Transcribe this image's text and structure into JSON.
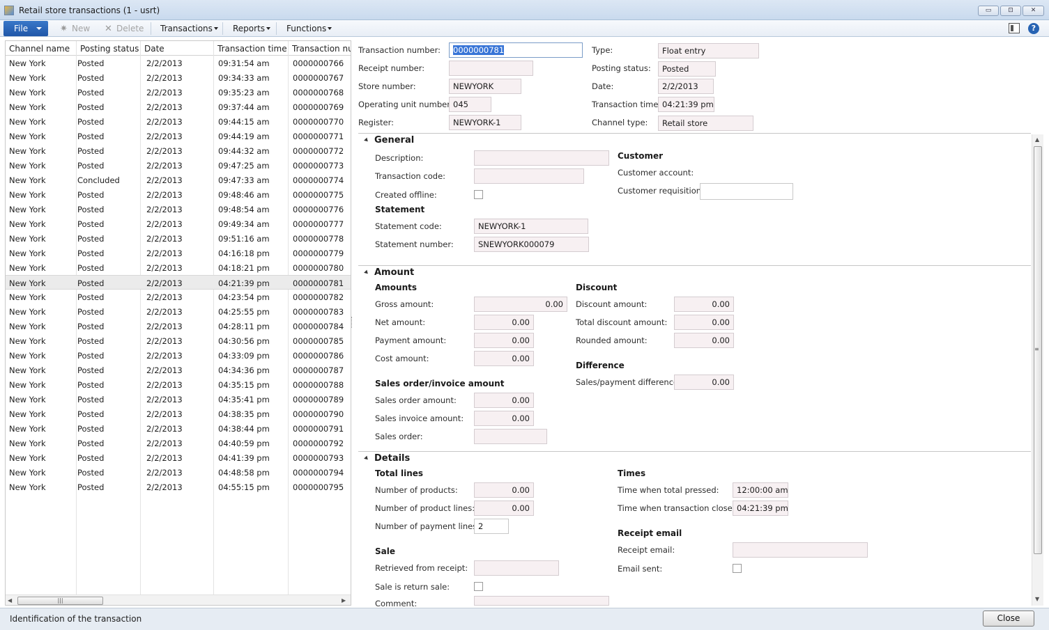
{
  "window": {
    "title": "Retail store transactions (1 - usrt)",
    "min_glyph": "▭",
    "max_glyph": "⊡",
    "close_glyph": "✕"
  },
  "toolbar": {
    "file_label": "File",
    "new_label": "New",
    "delete_label": "Delete",
    "transactions_label": "Transactions",
    "reports_label": "Reports",
    "functions_label": "Functions",
    "new_icon_glyph": "✷",
    "delete_icon_glyph": "✕",
    "help_glyph": "?"
  },
  "grid": {
    "columns": [
      "Channel name",
      "Posting status",
      "Date",
      "Transaction time",
      "Transaction number"
    ],
    "selected_index": 15,
    "rows": [
      [
        "New York",
        "Posted",
        "2/2/2013",
        "09:31:54 am",
        "0000000766"
      ],
      [
        "New York",
        "Posted",
        "2/2/2013",
        "09:34:33 am",
        "0000000767"
      ],
      [
        "New York",
        "Posted",
        "2/2/2013",
        "09:35:23 am",
        "0000000768"
      ],
      [
        "New York",
        "Posted",
        "2/2/2013",
        "09:37:44 am",
        "0000000769"
      ],
      [
        "New York",
        "Posted",
        "2/2/2013",
        "09:44:15 am",
        "0000000770"
      ],
      [
        "New York",
        "Posted",
        "2/2/2013",
        "09:44:19 am",
        "0000000771"
      ],
      [
        "New York",
        "Posted",
        "2/2/2013",
        "09:44:32 am",
        "0000000772"
      ],
      [
        "New York",
        "Posted",
        "2/2/2013",
        "09:47:25 am",
        "0000000773"
      ],
      [
        "New York",
        "Concluded",
        "2/2/2013",
        "09:47:33 am",
        "0000000774"
      ],
      [
        "New York",
        "Posted",
        "2/2/2013",
        "09:48:46 am",
        "0000000775"
      ],
      [
        "New York",
        "Posted",
        "2/2/2013",
        "09:48:54 am",
        "0000000776"
      ],
      [
        "New York",
        "Posted",
        "2/2/2013",
        "09:49:34 am",
        "0000000777"
      ],
      [
        "New York",
        "Posted",
        "2/2/2013",
        "09:51:16 am",
        "0000000778"
      ],
      [
        "New York",
        "Posted",
        "2/2/2013",
        "04:16:18 pm",
        "0000000779"
      ],
      [
        "New York",
        "Posted",
        "2/2/2013",
        "04:18:21 pm",
        "0000000780"
      ],
      [
        "New York",
        "Posted",
        "2/2/2013",
        "04:21:39 pm",
        "0000000781"
      ],
      [
        "New York",
        "Posted",
        "2/2/2013",
        "04:23:54 pm",
        "0000000782"
      ],
      [
        "New York",
        "Posted",
        "2/2/2013",
        "04:25:55 pm",
        "0000000783"
      ],
      [
        "New York",
        "Posted",
        "2/2/2013",
        "04:28:11 pm",
        "0000000784"
      ],
      [
        "New York",
        "Posted",
        "2/2/2013",
        "04:30:56 pm",
        "0000000785"
      ],
      [
        "New York",
        "Posted",
        "2/2/2013",
        "04:33:09 pm",
        "0000000786"
      ],
      [
        "New York",
        "Posted",
        "2/2/2013",
        "04:34:36 pm",
        "0000000787"
      ],
      [
        "New York",
        "Posted",
        "2/2/2013",
        "04:35:15 pm",
        "0000000788"
      ],
      [
        "New York",
        "Posted",
        "2/2/2013",
        "04:35:41 pm",
        "0000000789"
      ],
      [
        "New York",
        "Posted",
        "2/2/2013",
        "04:38:35 pm",
        "0000000790"
      ],
      [
        "New York",
        "Posted",
        "2/2/2013",
        "04:38:44 pm",
        "0000000791"
      ],
      [
        "New York",
        "Posted",
        "2/2/2013",
        "04:40:59 pm",
        "0000000792"
      ],
      [
        "New York",
        "Posted",
        "2/2/2013",
        "04:41:39 pm",
        "0000000793"
      ],
      [
        "New York",
        "Posted",
        "2/2/2013",
        "04:48:58 pm",
        "0000000794"
      ],
      [
        "New York",
        "Posted",
        "2/2/2013",
        "04:55:15 pm",
        "0000000795"
      ]
    ]
  },
  "header_fields": {
    "transaction_number": {
      "label": "Transaction number:",
      "value": "0000000781"
    },
    "receipt_number": {
      "label": "Receipt number:",
      "value": ""
    },
    "store_number": {
      "label": "Store number:",
      "value": "NEWYORK"
    },
    "operating_unit_number": {
      "label": "Operating unit number:",
      "value": "045"
    },
    "register": {
      "label": "Register:",
      "value": "NEWYORK-1"
    },
    "type": {
      "label": "Type:",
      "value": "Float entry"
    },
    "posting_status": {
      "label": "Posting status:",
      "value": "Posted"
    },
    "date": {
      "label": "Date:",
      "value": "2/2/2013"
    },
    "transaction_time": {
      "label": "Transaction time:",
      "value": "04:21:39 pm"
    },
    "channel_type": {
      "label": "Channel type:",
      "value": "Retail store"
    }
  },
  "general": {
    "title": "General",
    "description": {
      "label": "Description:",
      "value": ""
    },
    "transaction_code": {
      "label": "Transaction code:",
      "value": ""
    },
    "created_offline": {
      "label": "Created offline:"
    },
    "statement_group": "Statement",
    "statement_code": {
      "label": "Statement code:",
      "value": "NEWYORK-1"
    },
    "statement_number": {
      "label": "Statement number:",
      "value": "SNEWYORK000079"
    },
    "customer_group": "Customer",
    "customer_account": {
      "label": "Customer account:"
    },
    "customer_requisition": {
      "label": "Customer requisition:",
      "value": ""
    }
  },
  "amount": {
    "title": "Amount",
    "amounts_group": "Amounts",
    "gross_amount": {
      "label": "Gross amount:",
      "value": "0.00"
    },
    "net_amount": {
      "label": "Net amount:",
      "value": "0.00"
    },
    "payment_amount": {
      "label": "Payment amount:",
      "value": "0.00"
    },
    "cost_amount": {
      "label": "Cost amount:",
      "value": "0.00"
    },
    "sales_group": "Sales order/invoice amount",
    "sales_order_amount": {
      "label": "Sales order amount:",
      "value": "0.00"
    },
    "sales_invoice_amount": {
      "label": "Sales invoice amount:",
      "value": "0.00"
    },
    "sales_order": {
      "label": "Sales order:",
      "value": ""
    },
    "discount_group": "Discount",
    "discount_amount": {
      "label": "Discount amount:",
      "value": "0.00"
    },
    "total_discount_amount": {
      "label": "Total discount amount:",
      "value": "0.00"
    },
    "rounded_amount": {
      "label": "Rounded amount:",
      "value": "0.00"
    },
    "difference_group": "Difference",
    "sales_payment_difference": {
      "label": "Sales/payment difference:",
      "value": "0.00"
    }
  },
  "details": {
    "title": "Details",
    "total_lines_group": "Total lines",
    "number_of_products": {
      "label": "Number of products:",
      "value": "0.00"
    },
    "number_of_product_lines": {
      "label": "Number of product lines:",
      "value": "0.00"
    },
    "number_of_payment_lines": {
      "label": "Number of payment lines:",
      "value": "2"
    },
    "sale_group": "Sale",
    "retrieved_from_receipt": {
      "label": "Retrieved from receipt:",
      "value": ""
    },
    "sale_is_return_sale": {
      "label": "Sale is return sale:"
    },
    "comment": {
      "label": "Comment:",
      "value": ""
    },
    "times_group": "Times",
    "time_when_total_pressed": {
      "label": "Time when total pressed:",
      "value": "12:00:00 am"
    },
    "time_when_transaction_closed": {
      "label": "Time when transaction closed:",
      "value": "04:21:39 pm"
    },
    "receipt_email_group": "Receipt email",
    "receipt_email": {
      "label": "Receipt email:",
      "value": ""
    },
    "email_sent": {
      "label": "Email sent:"
    }
  },
  "status": {
    "text": "Identification of the transaction",
    "close_label": "Close"
  }
}
